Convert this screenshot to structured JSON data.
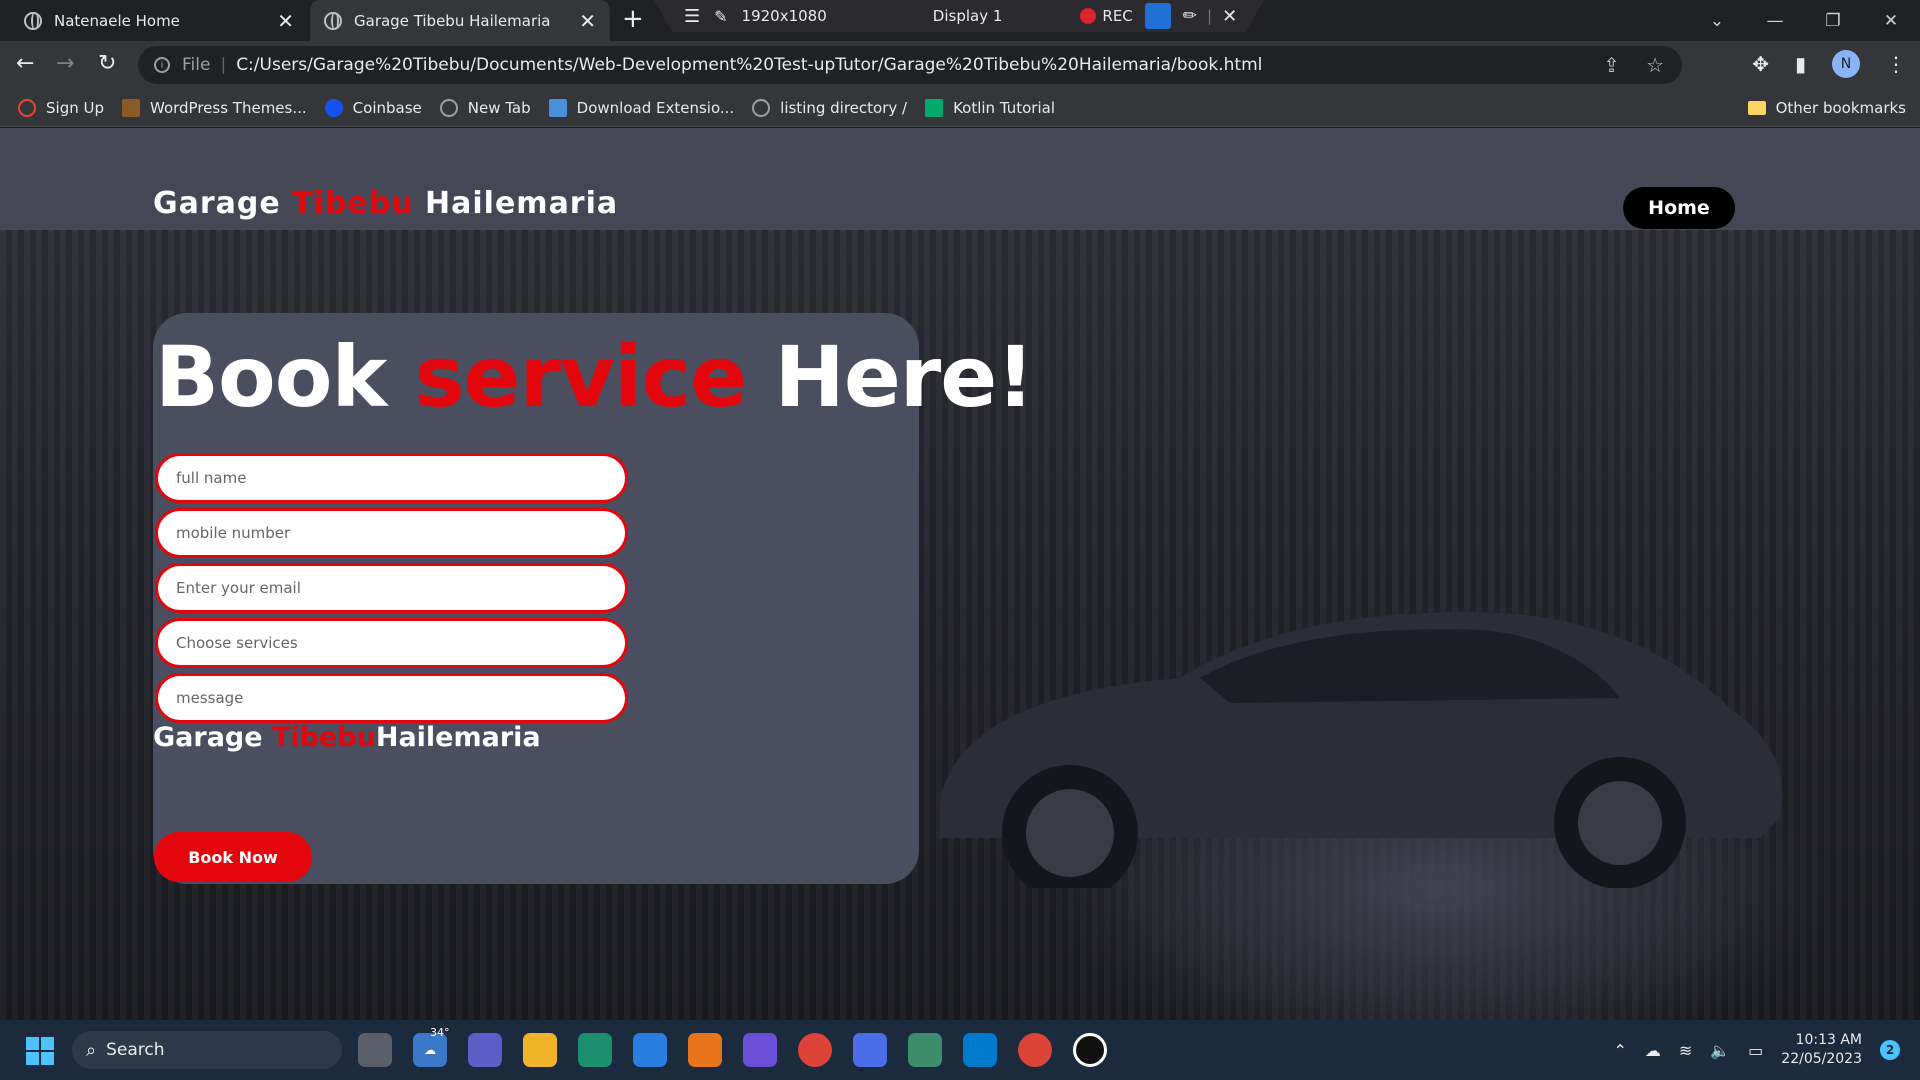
{
  "browser": {
    "tabs": [
      {
        "title": "Natenaele Home"
      },
      {
        "title": "Garage Tibebu Hailemaria"
      }
    ],
    "recorder": {
      "resolution": "1920x1080",
      "display": "Display 1",
      "rec": "REC"
    },
    "address": {
      "scheme_label": "File",
      "url": "C:/Users/Garage%20Tibebu/Documents/Web-Development%20Test-upTutor/Garage%20Tibebu%20Hailemaria/book.html"
    },
    "profile_initial": "N",
    "bookmarks": [
      {
        "label": "Sign Up",
        "color": "#ea4335"
      },
      {
        "label": "WordPress Themes...",
        "color": "#8a5a2b"
      },
      {
        "label": "Coinbase",
        "color": "#1652f0"
      },
      {
        "label": "New Tab",
        "color": "#9aa0a6"
      },
      {
        "label": "Download Extensio...",
        "color": "#4a90d9"
      },
      {
        "label": "listing directory /",
        "color": "#9aa0a6"
      },
      {
        "label": "Kotlin Tutorial",
        "color": "#04aa6d"
      }
    ],
    "other_bookmarks": "Other bookmarks"
  },
  "site": {
    "brand": {
      "part1": "Garage ",
      "part2": "Tibebu",
      "part3": " Hailemaria"
    },
    "nav": {
      "home": "Home"
    },
    "headline": {
      "part1": "Book ",
      "part2": "service",
      "part3": " Here!"
    },
    "form": {
      "full_name": "full name",
      "mobile": "mobile number",
      "email": "Enter your email",
      "services": "Choose services",
      "message": "message"
    },
    "card_brand": {
      "part1": "Garage ",
      "part2": "Tibebu",
      "part3": "Hailemaria"
    },
    "book_button": "Book Now",
    "accent_color": "#e3060d"
  },
  "taskbar": {
    "search": "Search",
    "weather": "34°",
    "time": "10:13 AM",
    "date": "22/05/2023",
    "notification_count": "2"
  }
}
